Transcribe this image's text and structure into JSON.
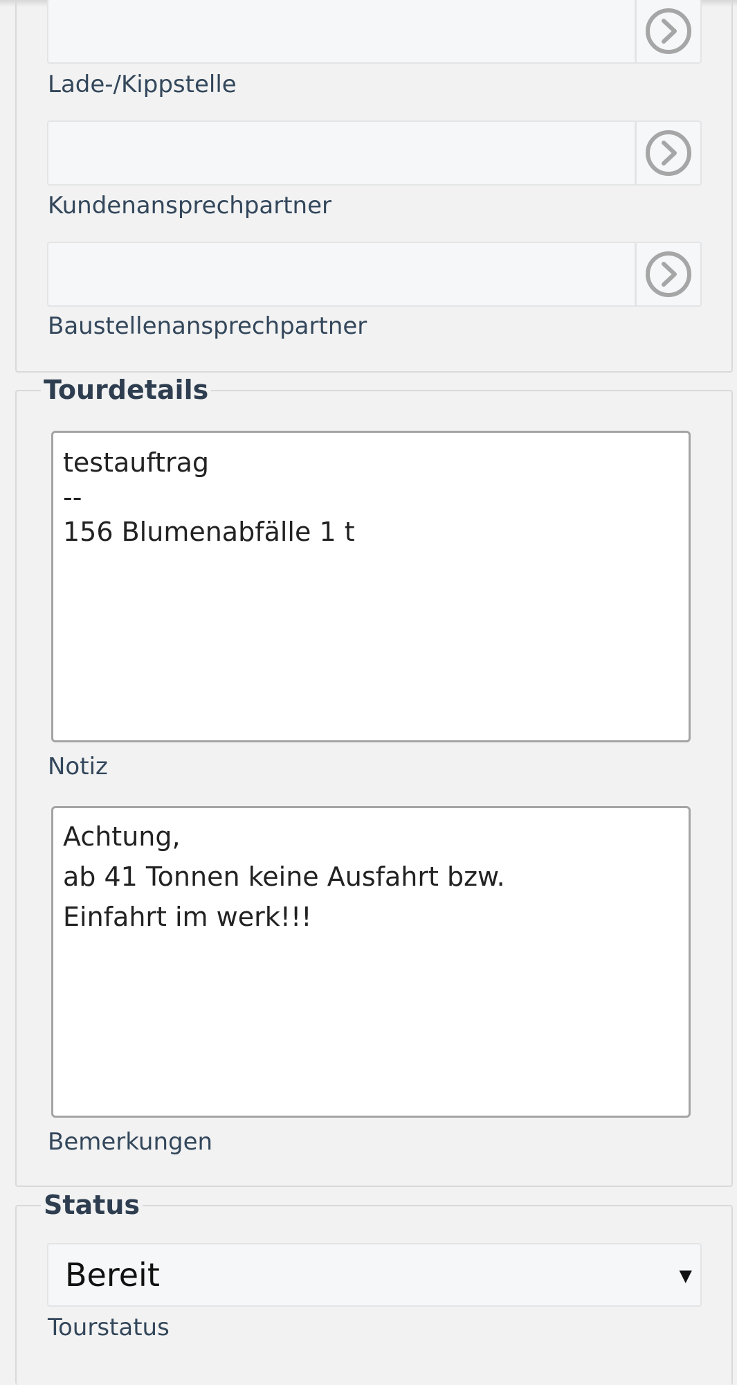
{
  "partner_section": {
    "fields": [
      {
        "label": "Lade-/Kippstelle",
        "value": ""
      },
      {
        "label": "Kundenansprechpartner",
        "value": ""
      },
      {
        "label": "Baustellenansprechpartner",
        "value": ""
      }
    ],
    "button_icon": "chevron-right-circle-icon"
  },
  "tour_section": {
    "legend": "Tourdetails",
    "notiz": {
      "label": "Notiz",
      "value": "testauftrag\n--\n156 Blumenabfälle 1 t"
    },
    "bemerkungen": {
      "label": "Bemerkungen",
      "value": "Achtung,\nab 41 Tonnen keine Ausfahrt bzw.\nEinfahrt im werk!!!"
    }
  },
  "status_section": {
    "legend": "Status",
    "tourstatus": {
      "label": "Tourstatus",
      "selected": "Bereit",
      "arrow": "▼"
    }
  },
  "colors": {
    "background": "#f2f2f2",
    "label": "#33475b",
    "input_bg": "#f5f7f8",
    "icon": "#a6a6a6"
  }
}
